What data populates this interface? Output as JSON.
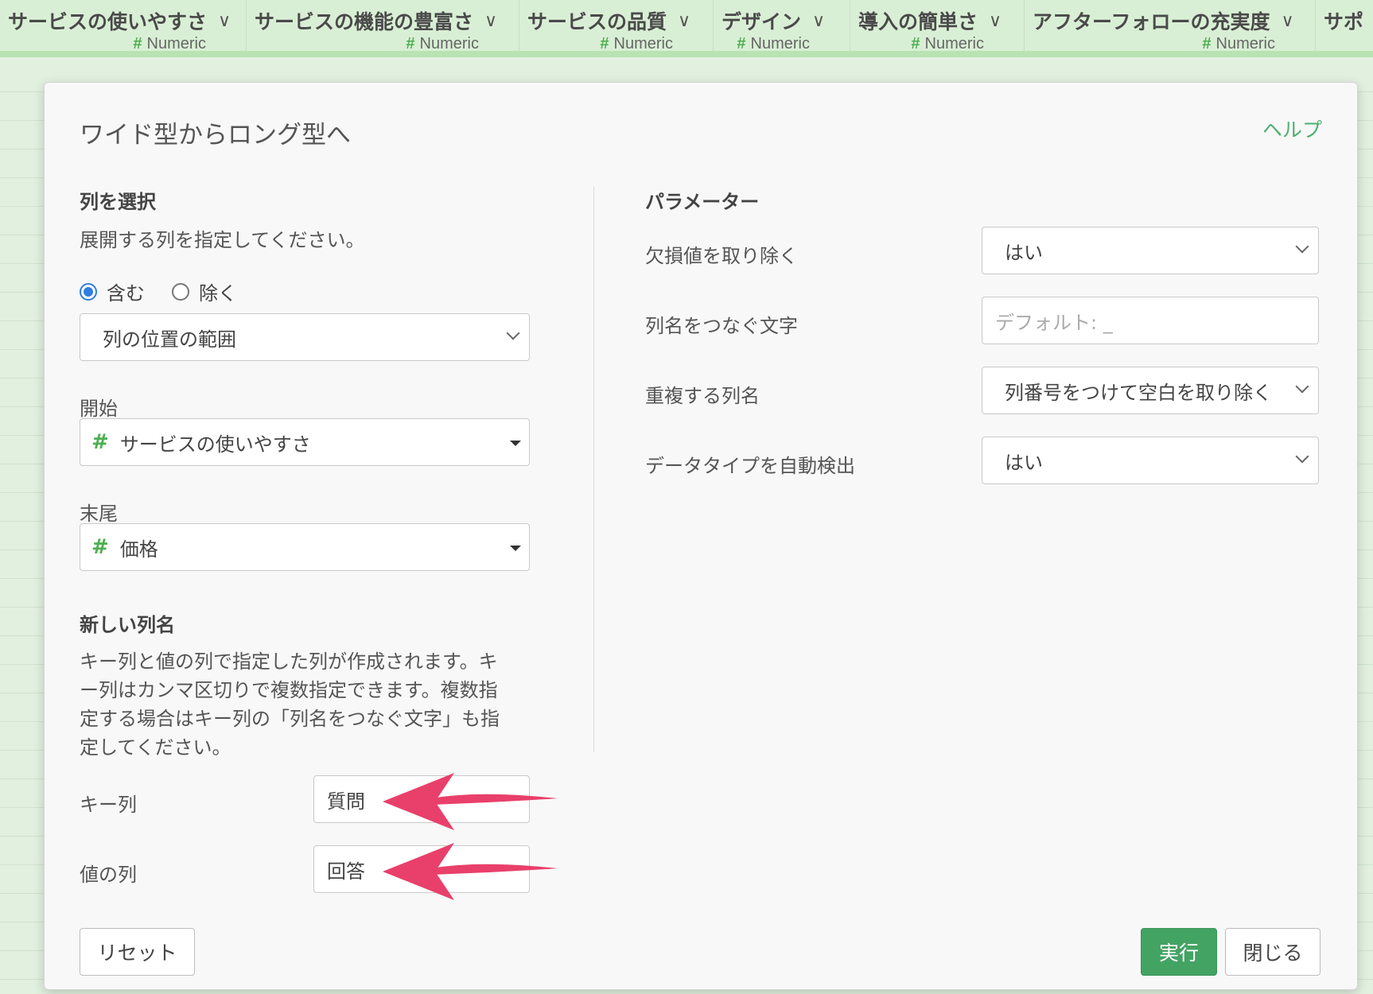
{
  "grid": {
    "columns": [
      {
        "name": "サービスの使いやすさ",
        "type": "Numeric"
      },
      {
        "name": "サービスの機能の豊富さ",
        "type": "Numeric"
      },
      {
        "name": "サービスの品質",
        "type": "Numeric"
      },
      {
        "name": "デザイン",
        "type": "Numeric"
      },
      {
        "name": "導入の簡単さ",
        "type": "Numeric"
      },
      {
        "name": "アフターフォローの充実度",
        "type": "Numeric"
      },
      {
        "name": "サポ"
      }
    ]
  },
  "dialog": {
    "title": "ワイド型からロング型へ",
    "help": "ヘルプ",
    "left": {
      "select_columns_title": "列を選択",
      "select_columns_desc": "展開する列を指定してください。",
      "radio_include": "含む",
      "radio_exclude": "除く",
      "selection_mode": "列の位置の範囲",
      "start_label": "開始",
      "start_value": "サービスの使いやすさ",
      "end_label": "末尾",
      "end_value": "価格",
      "new_names_title": "新しい列名",
      "new_names_desc_1": "キー列と値の列で指定した列が作成されます。キ",
      "new_names_desc_2": "ー列はカンマ区切りで複数指定できます。複数指",
      "new_names_desc_3": "定する場合はキー列の「列名をつなぐ文字」も指",
      "new_names_desc_4": "定してください。",
      "key_label": "キー列",
      "key_value": "質問",
      "value_label": "値の列",
      "value_value": "回答"
    },
    "right": {
      "params_title": "パラメーター",
      "remove_na_label": "欠損値を取り除く",
      "remove_na_value": "はい",
      "sep_label": "列名をつなぐ文字",
      "sep_placeholder": "デフォルト: _",
      "dup_label": "重複する列名",
      "dup_value": "列番号をつけて空白を取り除く",
      "detect_label": "データタイプを自動検出",
      "detect_value": "はい"
    },
    "buttons": {
      "reset": "リセット",
      "run": "実行",
      "close": "閉じる"
    }
  },
  "colors": {
    "accent_green": "#43a363",
    "arrow_pink": "#e8406a",
    "radio_blue": "#2f7de1"
  }
}
